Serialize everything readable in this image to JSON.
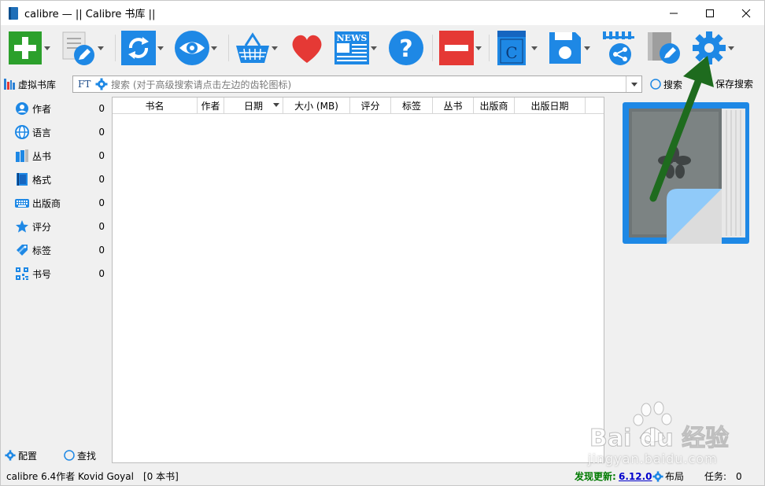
{
  "window": {
    "title": "calibre — || Calibre 书库 ||",
    "minimize_glyph": "—",
    "maximize_glyph": "☐",
    "close_glyph": "✕"
  },
  "toolbar": {
    "buttons": [
      {
        "name": "add-books",
        "icon": "plus-icon",
        "color": "#2ca02c"
      },
      {
        "name": "edit-metadata",
        "icon": "edit-icon",
        "color": "#1e88e5"
      },
      {
        "name": "convert-books",
        "icon": "convert-icon",
        "color": "#1e88e5"
      },
      {
        "name": "view",
        "icon": "eye-icon",
        "color": "#1e88e5"
      },
      {
        "name": "store",
        "icon": "basket-icon",
        "color": "#1e88e5"
      },
      {
        "name": "donate",
        "icon": "heart-icon",
        "color": "#e53935"
      },
      {
        "name": "fetch-news",
        "icon": "news-icon",
        "color": "#1e88e5"
      },
      {
        "name": "help",
        "icon": "help-icon",
        "color": "#1e88e5"
      },
      {
        "name": "remove-books",
        "icon": "remove-icon",
        "color": "#e53935"
      },
      {
        "name": "calibre-library",
        "icon": "library-icon",
        "color": "#1e88e5"
      },
      {
        "name": "save-to-disk",
        "icon": "save-icon",
        "color": "#1e88e5"
      },
      {
        "name": "connect-share",
        "icon": "share-icon",
        "color": "#1e88e5"
      },
      {
        "name": "edit-book",
        "icon": "edit-book-icon",
        "color": "#1e88e5"
      },
      {
        "name": "preferences",
        "icon": "gear-icon",
        "color": "#1e88e5"
      }
    ]
  },
  "search": {
    "virtual_library": "虚拟书库",
    "ft_label": "FT",
    "placeholder": "搜索 (对于高级搜索请点击左边的齿轮图标)",
    "search_button": "搜索",
    "save_search": "保存搜索"
  },
  "tag_browser": {
    "items": [
      {
        "label": "作者",
        "count": "0",
        "icon": "author-icon"
      },
      {
        "label": "语言",
        "count": "0",
        "icon": "language-icon"
      },
      {
        "label": "丛书",
        "count": "0",
        "icon": "series-icon"
      },
      {
        "label": "格式",
        "count": "0",
        "icon": "format-icon"
      },
      {
        "label": "出版商",
        "count": "0",
        "icon": "publisher-icon"
      },
      {
        "label": "评分",
        "count": "0",
        "icon": "rating-star-icon"
      },
      {
        "label": "标签",
        "count": "0",
        "icon": "tag-icon"
      },
      {
        "label": "书号",
        "count": "0",
        "icon": "identifier-icon"
      }
    ],
    "config": "配置",
    "find": "查找"
  },
  "library": {
    "columns": [
      "书名",
      "作者",
      "日期",
      "大小 (MB)",
      "评分",
      "标签",
      "丛书",
      "出版商",
      "出版日期"
    ],
    "rows": []
  },
  "status": {
    "left": "calibre 6.4作者 Kovid Goyal",
    "book_count": "[0 本书]",
    "update_label": "发现更新:",
    "update_version": "6.12.0",
    "layout": "布局",
    "jobs_label": "任务:",
    "jobs_count": "0"
  },
  "annotation": {
    "arrow_color": "#1e6b1e"
  },
  "watermark": {
    "text": "jingyan.baidu.com"
  }
}
